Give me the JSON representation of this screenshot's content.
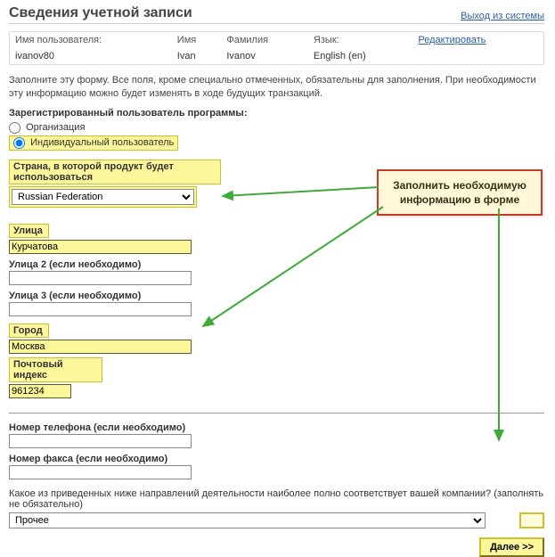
{
  "header": {
    "title": "Сведения учетной записи",
    "logout": "Выход из системы"
  },
  "user_info": {
    "headers": {
      "username": "Имя пользователя:",
      "first": "Имя",
      "last": "Фамилия",
      "lang": "Язык:",
      "edit": "Редактировать"
    },
    "values": {
      "username": "ivanov80",
      "first": "Ivan",
      "last": "Ivanov",
      "lang": "English (en)"
    }
  },
  "intro": "Заполните эту форму. Все поля, кроме специально отмеченных, обязательны для заполнения. При необходимости эту информацию можно будет изменять в ходе будущих транзакций.",
  "user_type": {
    "legend": "Зарегистрированный пользователь программы:",
    "org": "Организация",
    "ind": "Индивидуальный пользователь",
    "selected": "ind"
  },
  "country": {
    "label": "Страна, в которой продукт будет использоваться",
    "value": "Russian Federation"
  },
  "street": {
    "label": "Улица",
    "value": "Курчатова"
  },
  "street2": {
    "label": "Улица 2 (если необходимо)",
    "value": ""
  },
  "street3": {
    "label": "Улица 3 (если необходимо)",
    "value": ""
  },
  "city": {
    "label": "Город",
    "value": "Москва"
  },
  "zip": {
    "label": "Почтовый индекс",
    "value": "961234"
  },
  "phone": {
    "label": "Номер телефона (если необходимо)",
    "value": ""
  },
  "fax": {
    "label": "Номер факса (если необходимо)",
    "value": ""
  },
  "activity": {
    "question": "Какое из приведенных ниже направлений деятельности наиболее полно соответствует вашей компании? (заполнять не обязательно)",
    "value": "Прочее"
  },
  "buttons": {
    "next": "Далее >>"
  },
  "callout": {
    "line1": "Заполнить необходимую",
    "line2": "информацию в форме"
  }
}
